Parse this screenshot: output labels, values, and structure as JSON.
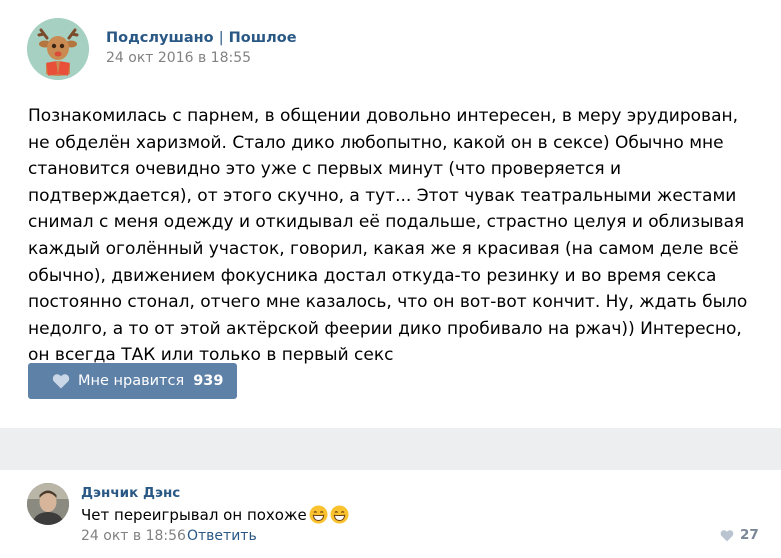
{
  "post": {
    "group_name": "Подслушано",
    "separator": "|",
    "group_category": "Пошлое",
    "date": "24 окт 2016 в 18:55",
    "text": "Познакомилась с парнем, в общении довольно интересен, в меру эрудирован, не обделён харизмой. Стало дико любопытно, какой он в сексе) Обычно мне становится очевидно это уже с первых минут (что проверяется и подтверждается), от этого скучно, а тут... Этот чувак театральными жестами снимал с меня одежду и откидывал её подальше, страстно целуя и облизывая каждый оголённый участок, говорил, какая же я красивая (на самом деле всё обычно), движением фокусника достал откуда-то резинку и во время секса постоянно стонал, отчего мне казалось, что он вот-вот кончит. Ну, ждать было недолго, а то от этой актёрской феерии дико пробивало на ржач)) Интересно, он всегда ТАК или только в первый секс",
    "like_label": "Мне нравится",
    "like_count": "939"
  },
  "comment": {
    "author": "Дэнчик Дэнс",
    "text": "Чет переигрывал он похоже",
    "emojis": [
      "grinning-face",
      "grinning-face"
    ],
    "date": "24 окт в 18:56",
    "reply_label": "Ответить",
    "like_count": "27"
  },
  "colors": {
    "link": "#2a5885",
    "like_button": "#5e81a8",
    "muted": "#828282",
    "page_bg": "#edeef0"
  }
}
